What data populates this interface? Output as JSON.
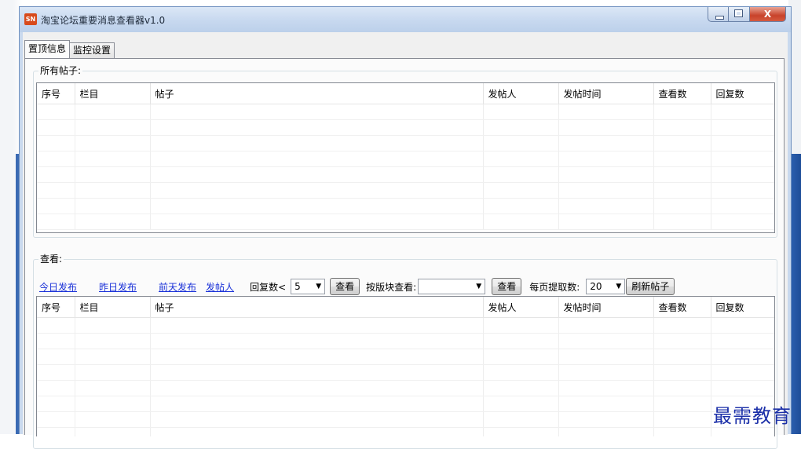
{
  "window": {
    "title": "淘宝论坛重要消息查看器v1.0",
    "app_icon_label": "SN",
    "close_glyph": "X"
  },
  "tabs": [
    {
      "label": "置顶信息",
      "active": true
    },
    {
      "label": "监控设置",
      "active": false
    }
  ],
  "all_posts": {
    "group_label": "所有帖子:",
    "columns": [
      "序号",
      "栏目",
      "帖子",
      "发帖人",
      "发帖时间",
      "查看数",
      "回复数"
    ]
  },
  "view": {
    "group_label": "查看:",
    "links": {
      "today": "今日发布",
      "yesterday": "昨日发布",
      "day_before": "前天发布",
      "poster": "发帖人"
    },
    "reply_count_label": "回复数<",
    "reply_count_value": "5",
    "view_button": "查看",
    "by_section_label": "按版块查看:",
    "section_value": "",
    "view_button_2": "查看",
    "per_page_label": "每页提取数:",
    "per_page_value": "20",
    "refresh_button": "刷新帖子",
    "columns": [
      "序号",
      "栏目",
      "帖子",
      "发帖人",
      "发帖时间",
      "查看数",
      "回复数"
    ]
  },
  "watermark": "最需教育",
  "colors": {
    "link": "#1a31d8",
    "window_frame": "#c9d9ee",
    "close_button": "#c8432b",
    "watermark": "#1b2fa8"
  }
}
